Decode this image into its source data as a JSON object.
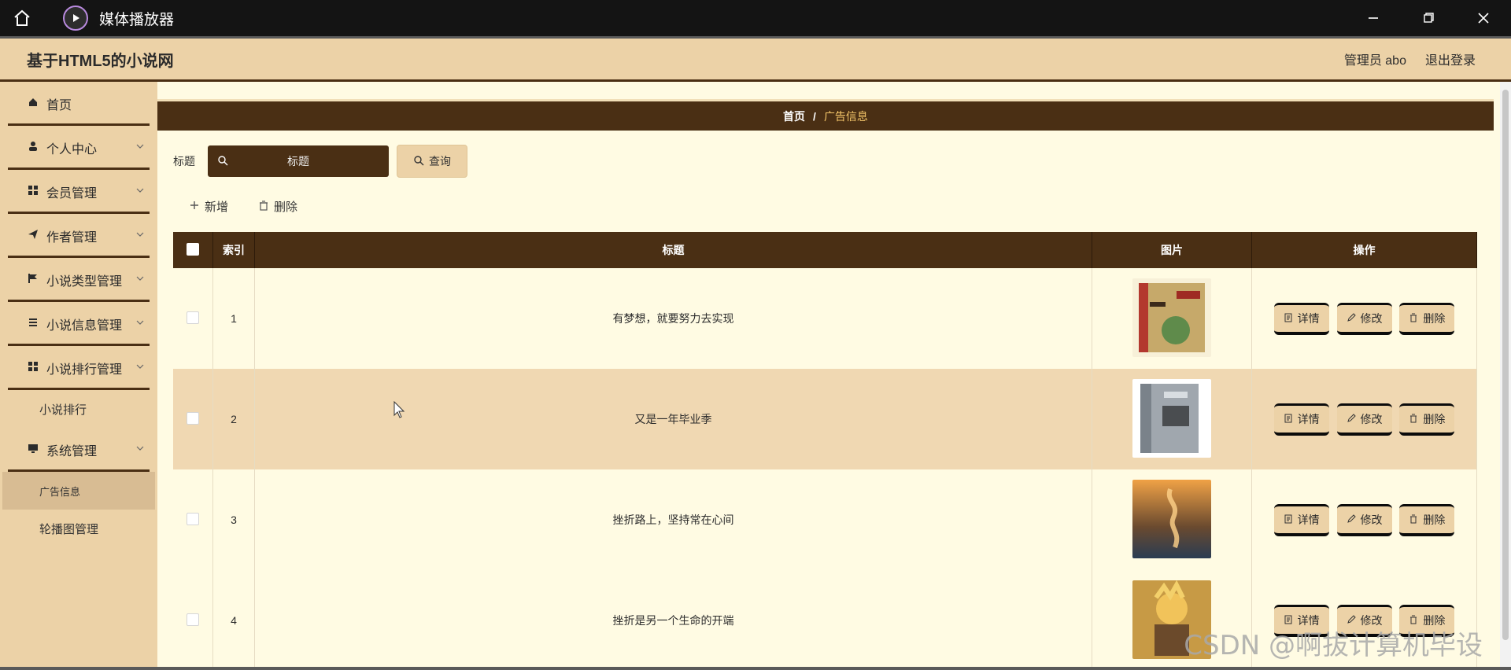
{
  "window": {
    "app_title": "媒体播放器",
    "minimize_icon": "minimize-icon",
    "restore_icon": "restore-icon",
    "close_icon": "close-icon"
  },
  "header": {
    "site_title": "基于HTML5的小说网",
    "user_label": "管理员 abo",
    "logout_label": "退出登录"
  },
  "sidebar": {
    "items": [
      {
        "label": "首页",
        "icon": "home-icon",
        "has_chevron": false
      },
      {
        "label": "个人中心",
        "icon": "user-icon",
        "has_chevron": true
      },
      {
        "label": "会员管理",
        "icon": "grid-icon",
        "has_chevron": true
      },
      {
        "label": "作者管理",
        "icon": "send-icon",
        "has_chevron": true
      },
      {
        "label": "小说类型管理",
        "icon": "flag-icon",
        "has_chevron": true
      },
      {
        "label": "小说信息管理",
        "icon": "list-icon",
        "has_chevron": true
      },
      {
        "label": "小说排行管理",
        "icon": "grid-icon",
        "has_chevron": true
      }
    ],
    "sub_ranking": "小说排行",
    "system_mgmt": {
      "label": "系统管理",
      "icon": "monitor-icon"
    },
    "sub_system": [
      {
        "label": "广告信息",
        "active": true
      },
      {
        "label": "轮播图管理",
        "active": false
      }
    ]
  },
  "breadcrumb": {
    "home": "首页",
    "sep": "/",
    "current": "广告信息"
  },
  "search": {
    "label": "标题",
    "placeholder": "标题",
    "query_button": "查询"
  },
  "toolbar": {
    "add_label": "新增",
    "delete_label": "删除"
  },
  "table": {
    "headers": {
      "select": "",
      "index": "索引",
      "title": "标题",
      "image": "图片",
      "ops": "操作"
    },
    "rows": [
      {
        "index": "1",
        "title": "有梦想，就要努力去实现",
        "image": "book-cover-zhuangzi"
      },
      {
        "index": "2",
        "title": "又是一年毕业季",
        "image": "book-cover-grey-hardcover"
      },
      {
        "index": "3",
        "title": "挫折路上，坚持常在心间",
        "image": "book-cover-fire-art"
      },
      {
        "index": "4",
        "title": "挫折是另一个生命的开端",
        "image": "book-cover-anime-character"
      }
    ],
    "ops": {
      "detail": "详情",
      "edit": "修改",
      "delete": "删除"
    }
  },
  "watermark": "CSDN @啊拔计算机毕设"
}
